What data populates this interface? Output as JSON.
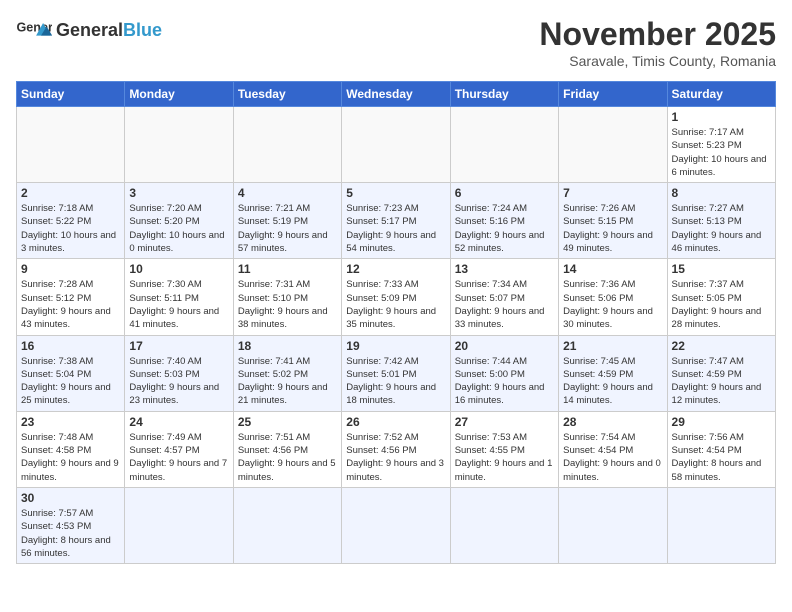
{
  "header": {
    "logo_general": "General",
    "logo_blue": "Blue",
    "month_title": "November 2025",
    "subtitle": "Saravale, Timis County, Romania"
  },
  "calendar": {
    "days_of_week": [
      "Sunday",
      "Monday",
      "Tuesday",
      "Wednesday",
      "Thursday",
      "Friday",
      "Saturday"
    ],
    "weeks": [
      {
        "alt": false,
        "days": [
          {
            "num": "",
            "info": ""
          },
          {
            "num": "",
            "info": ""
          },
          {
            "num": "",
            "info": ""
          },
          {
            "num": "",
            "info": ""
          },
          {
            "num": "",
            "info": ""
          },
          {
            "num": "",
            "info": ""
          },
          {
            "num": "1",
            "info": "Sunrise: 7:17 AM\nSunset: 5:23 PM\nDaylight: 10 hours\nand 6 minutes."
          }
        ]
      },
      {
        "alt": true,
        "days": [
          {
            "num": "2",
            "info": "Sunrise: 7:18 AM\nSunset: 5:22 PM\nDaylight: 10 hours\nand 3 minutes."
          },
          {
            "num": "3",
            "info": "Sunrise: 7:20 AM\nSunset: 5:20 PM\nDaylight: 10 hours\nand 0 minutes."
          },
          {
            "num": "4",
            "info": "Sunrise: 7:21 AM\nSunset: 5:19 PM\nDaylight: 9 hours\nand 57 minutes."
          },
          {
            "num": "5",
            "info": "Sunrise: 7:23 AM\nSunset: 5:17 PM\nDaylight: 9 hours\nand 54 minutes."
          },
          {
            "num": "6",
            "info": "Sunrise: 7:24 AM\nSunset: 5:16 PM\nDaylight: 9 hours\nand 52 minutes."
          },
          {
            "num": "7",
            "info": "Sunrise: 7:26 AM\nSunset: 5:15 PM\nDaylight: 9 hours\nand 49 minutes."
          },
          {
            "num": "8",
            "info": "Sunrise: 7:27 AM\nSunset: 5:13 PM\nDaylight: 9 hours\nand 46 minutes."
          }
        ]
      },
      {
        "alt": false,
        "days": [
          {
            "num": "9",
            "info": "Sunrise: 7:28 AM\nSunset: 5:12 PM\nDaylight: 9 hours\nand 43 minutes."
          },
          {
            "num": "10",
            "info": "Sunrise: 7:30 AM\nSunset: 5:11 PM\nDaylight: 9 hours\nand 41 minutes."
          },
          {
            "num": "11",
            "info": "Sunrise: 7:31 AM\nSunset: 5:10 PM\nDaylight: 9 hours\nand 38 minutes."
          },
          {
            "num": "12",
            "info": "Sunrise: 7:33 AM\nSunset: 5:09 PM\nDaylight: 9 hours\nand 35 minutes."
          },
          {
            "num": "13",
            "info": "Sunrise: 7:34 AM\nSunset: 5:07 PM\nDaylight: 9 hours\nand 33 minutes."
          },
          {
            "num": "14",
            "info": "Sunrise: 7:36 AM\nSunset: 5:06 PM\nDaylight: 9 hours\nand 30 minutes."
          },
          {
            "num": "15",
            "info": "Sunrise: 7:37 AM\nSunset: 5:05 PM\nDaylight: 9 hours\nand 28 minutes."
          }
        ]
      },
      {
        "alt": true,
        "days": [
          {
            "num": "16",
            "info": "Sunrise: 7:38 AM\nSunset: 5:04 PM\nDaylight: 9 hours\nand 25 minutes."
          },
          {
            "num": "17",
            "info": "Sunrise: 7:40 AM\nSunset: 5:03 PM\nDaylight: 9 hours\nand 23 minutes."
          },
          {
            "num": "18",
            "info": "Sunrise: 7:41 AM\nSunset: 5:02 PM\nDaylight: 9 hours\nand 21 minutes."
          },
          {
            "num": "19",
            "info": "Sunrise: 7:42 AM\nSunset: 5:01 PM\nDaylight: 9 hours\nand 18 minutes."
          },
          {
            "num": "20",
            "info": "Sunrise: 7:44 AM\nSunset: 5:00 PM\nDaylight: 9 hours\nand 16 minutes."
          },
          {
            "num": "21",
            "info": "Sunrise: 7:45 AM\nSunset: 4:59 PM\nDaylight: 9 hours\nand 14 minutes."
          },
          {
            "num": "22",
            "info": "Sunrise: 7:47 AM\nSunset: 4:59 PM\nDaylight: 9 hours\nand 12 minutes."
          }
        ]
      },
      {
        "alt": false,
        "days": [
          {
            "num": "23",
            "info": "Sunrise: 7:48 AM\nSunset: 4:58 PM\nDaylight: 9 hours\nand 9 minutes."
          },
          {
            "num": "24",
            "info": "Sunrise: 7:49 AM\nSunset: 4:57 PM\nDaylight: 9 hours\nand 7 minutes."
          },
          {
            "num": "25",
            "info": "Sunrise: 7:51 AM\nSunset: 4:56 PM\nDaylight: 9 hours\nand 5 minutes."
          },
          {
            "num": "26",
            "info": "Sunrise: 7:52 AM\nSunset: 4:56 PM\nDaylight: 9 hours\nand 3 minutes."
          },
          {
            "num": "27",
            "info": "Sunrise: 7:53 AM\nSunset: 4:55 PM\nDaylight: 9 hours\nand 1 minute."
          },
          {
            "num": "28",
            "info": "Sunrise: 7:54 AM\nSunset: 4:54 PM\nDaylight: 9 hours\nand 0 minutes."
          },
          {
            "num": "29",
            "info": "Sunrise: 7:56 AM\nSunset: 4:54 PM\nDaylight: 8 hours\nand 58 minutes."
          }
        ]
      },
      {
        "alt": true,
        "days": [
          {
            "num": "30",
            "info": "Sunrise: 7:57 AM\nSunset: 4:53 PM\nDaylight: 8 hours\nand 56 minutes."
          },
          {
            "num": "",
            "info": ""
          },
          {
            "num": "",
            "info": ""
          },
          {
            "num": "",
            "info": ""
          },
          {
            "num": "",
            "info": ""
          },
          {
            "num": "",
            "info": ""
          },
          {
            "num": "",
            "info": ""
          }
        ]
      }
    ]
  }
}
